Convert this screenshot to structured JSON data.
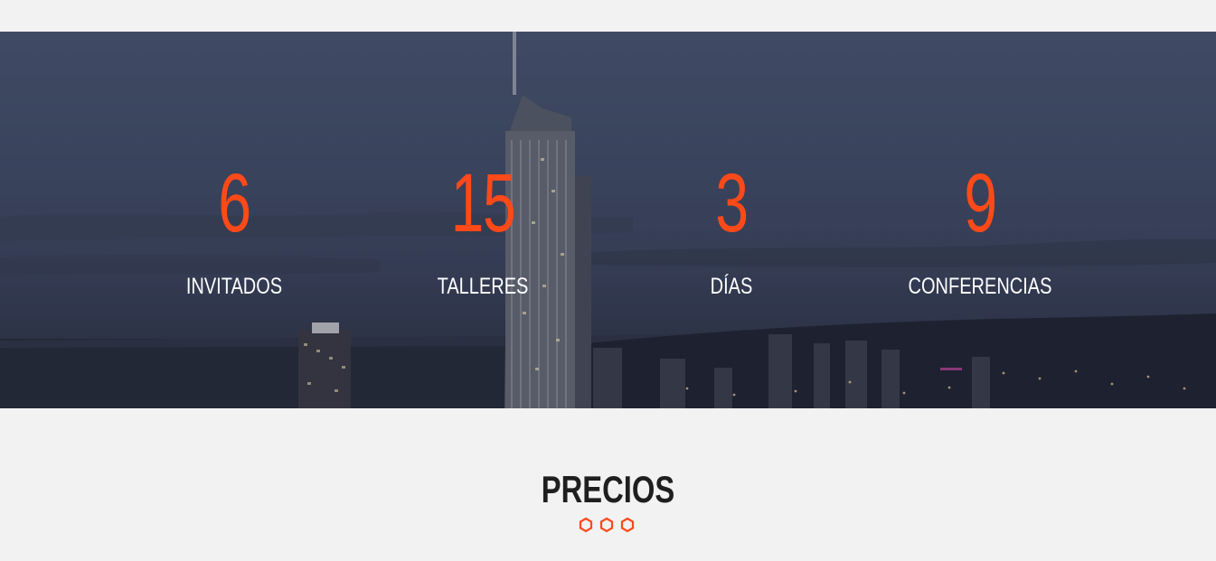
{
  "stats": [
    {
      "number": "6",
      "label": "INVITADOS"
    },
    {
      "number": "15",
      "label": "TALLERES"
    },
    {
      "number": "3",
      "label": "DÍAS"
    },
    {
      "number": "9",
      "label": "CONFERENCIAS"
    }
  ],
  "pricing": {
    "title": "PRECIOS"
  },
  "colors": {
    "accent": "#fe4918",
    "background": "#f2f2f2",
    "heading": "#1f1f1f",
    "stat_label": "#ffffff"
  },
  "icons": {
    "divider": "hexagon-icon"
  }
}
